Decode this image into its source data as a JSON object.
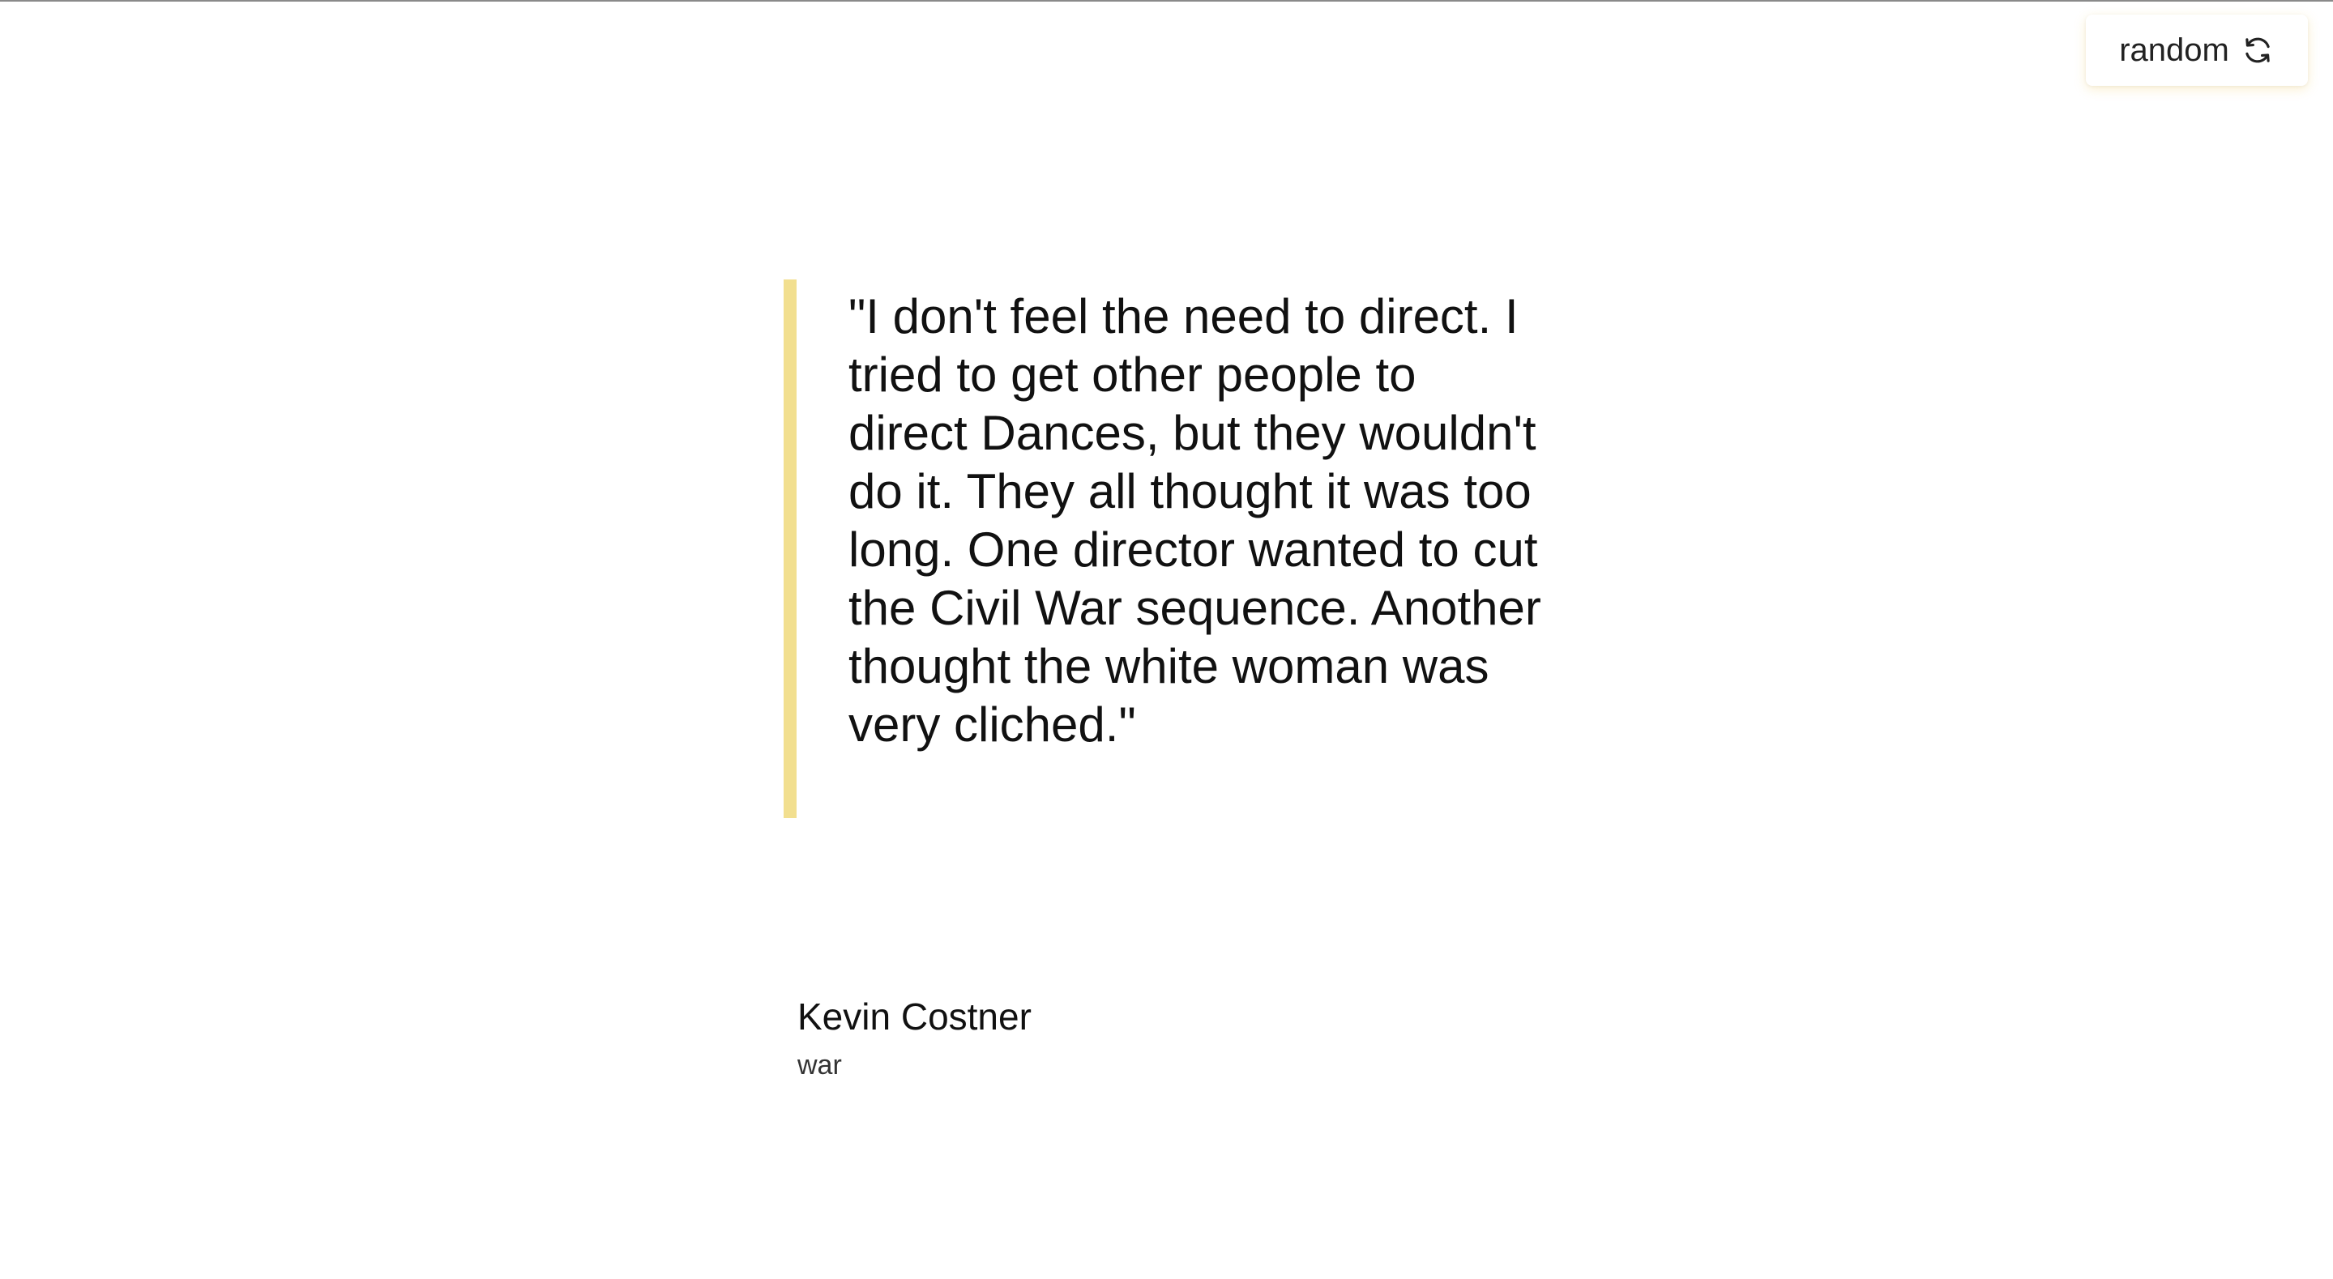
{
  "toolbar": {
    "random_label": "random",
    "random_icon": "refresh-icon"
  },
  "quote": {
    "text": "\"I don't feel the need to direct. I tried to get other people to direct Dances, but they wouldn't do it. They all thought it was too long. One director wanted to cut the Civil War sequence. Another thought the white woman was very cliched.\"",
    "author": "Kevin Costner",
    "genre": "war"
  },
  "colors": {
    "accent": "#f2df8f",
    "text": "#111111",
    "background": "#ffffff"
  }
}
